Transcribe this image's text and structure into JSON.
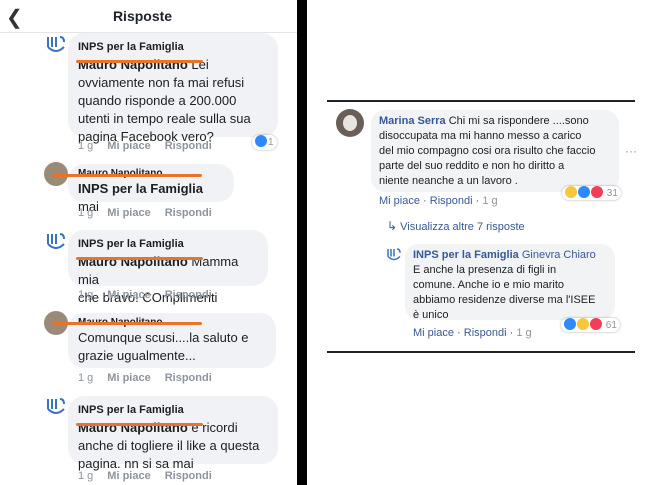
{
  "left": {
    "back_icon": "chevron-left-icon",
    "title": "Risposte",
    "comments": [
      {
        "author": "INPS per la Famiglia",
        "mention": "Mauro Napolitano",
        "line1": " Lei",
        "lines": [
          "ovviamente non fa mai refusi",
          "quando risponde a 200.000",
          "utenti in tempo reale sulla sua",
          "pagina Facebook vero?"
        ],
        "time": "1 g",
        "like": "Mi piace",
        "reply": "Rispondi",
        "reactions": "1"
      },
      {
        "author": "Mauro Napolitano",
        "mention": "INPS per la Famiglia",
        "line1": " mai",
        "lines": [],
        "time": "1 g",
        "like": "Mi piace",
        "reply": "Rispondi"
      },
      {
        "author": "INPS per la Famiglia",
        "mention": "Mauro Napolitano",
        "line1": " Mamma mia",
        "lines": [
          "che bravo! COmplimenti"
        ],
        "time": "1 g",
        "like": "Mi piace",
        "reply": "Rispondi"
      },
      {
        "author": "Mauro Napolitano",
        "mention": "",
        "line1": "Comunque scusi....la saluto e",
        "lines": [
          "grazie ugualmente..."
        ],
        "time": "1 g",
        "like": "Mi piace",
        "reply": "Rispondi"
      },
      {
        "author": "INPS per la Famiglia",
        "mention": "Mauro Napolitano",
        "line1": " e ricordi",
        "lines": [
          "anche di togliere il like a questa",
          "pagina. nn si sa mai"
        ],
        "time": "1 g",
        "like": "Mi piace",
        "reply": "Rispondi"
      }
    ]
  },
  "right": {
    "main": {
      "author": "Marina Serra",
      "text": "Chi mi sa rispondere ....sono disoccupata ma mi hanno messo a carico del mio compagno cosi ora risulto che faccio parte del suo reddito e non ho diritto a niente neanche a un lavoro .",
      "lines": [
        "Chi mi sa rispondere ....sono",
        "disoccupata ma mi hanno messo a carico",
        "del mio compagno cosi ora risulto che faccio",
        "parte del suo reddito e non ho diritto a",
        "niente neanche a un lavoro ."
      ],
      "like": "Mi piace",
      "reply": "Rispondi",
      "time": "1 g",
      "reactions": "31"
    },
    "view_more": "Visualizza altre 7 risposte",
    "reply": {
      "author": "INPS per la Famiglia",
      "mention": "Ginevra Chiaro",
      "lines": [
        "E anche la presenza di figli in",
        "comune. Anche io e mio marito",
        "abbiamo residenze diverse ma l'ISEE",
        "è unico"
      ],
      "like": "Mi piace",
      "reply": "Rispondi",
      "time": "1 g",
      "reactions": "61"
    }
  },
  "colors": {
    "strike": "#e8742a",
    "fb_link": "#385898",
    "bubble": "#f1f2f6",
    "inps_logo": "#3b73b9"
  }
}
